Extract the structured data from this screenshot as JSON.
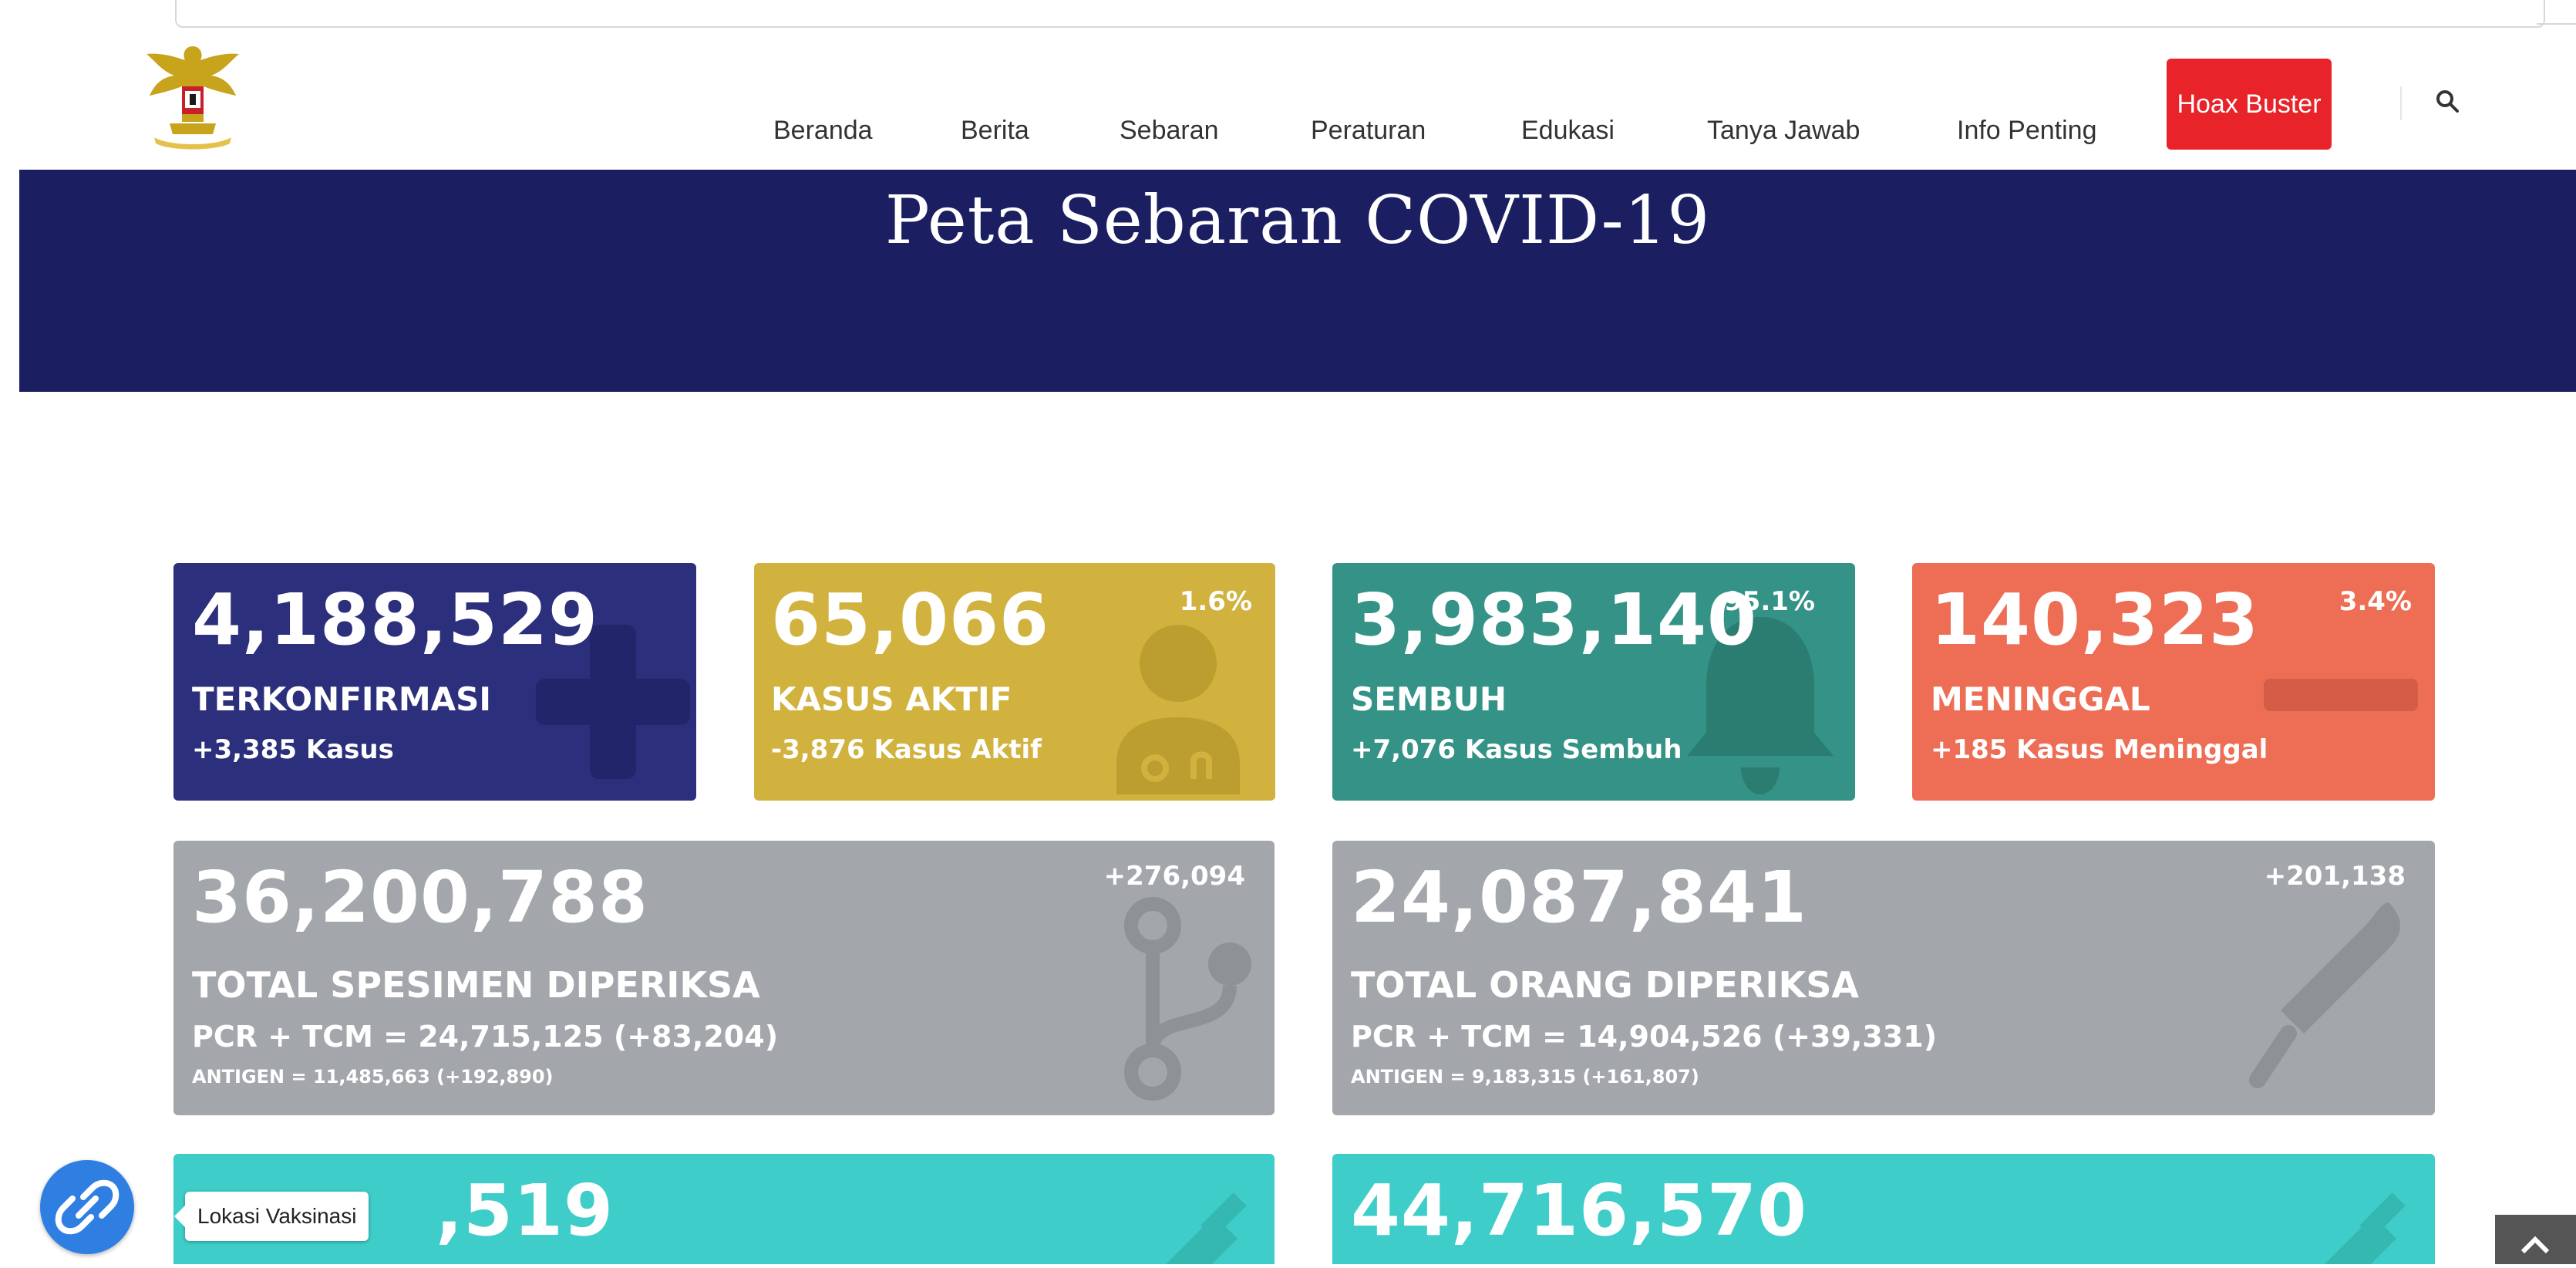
{
  "nav": {
    "items": [
      "Beranda",
      "Berita",
      "Sebaran",
      "Peraturan",
      "Edukasi",
      "Tanya Jawab",
      "Info Penting"
    ],
    "hoax_label": "Hoax Buster"
  },
  "hero": {
    "title": "Peta Sebaran COVID-19"
  },
  "stats": {
    "confirmed": {
      "value": "4,188,529",
      "label": "TERKONFIRMASI",
      "change": "+3,385 Kasus"
    },
    "active": {
      "value": "65,066",
      "label": "KASUS AKTIF",
      "change": "-3,876 Kasus Aktif",
      "percent": "1.6%"
    },
    "recovered": {
      "value": "3,983,140",
      "label": "SEMBUH",
      "change": "+7,076 Kasus Sembuh",
      "percent": "95.1%"
    },
    "deaths": {
      "value": "140,323",
      "label": "MENINGGAL",
      "change": "+185 Kasus Meninggal",
      "percent": "3.4%"
    }
  },
  "specimens": {
    "value": "36,200,788",
    "delta": "+276,094",
    "label": "TOTAL SPESIMEN DIPERIKSA",
    "pcr": "PCR + TCM = 24,715,125 (+83,204)",
    "antigen": "ANTIGEN = 11,485,663 (+192,890)"
  },
  "people": {
    "value": "24,087,841",
    "delta": "+201,138",
    "label": "TOTAL ORANG DIPERIKSA",
    "pcr": "PCR + TCM = 14,904,526 (+39,331)",
    "antigen": "ANTIGEN = 9,183,315 (+161,807)"
  },
  "vaccine": {
    "left_value": ",519",
    "right_value": "44,716,570"
  },
  "floating": {
    "tooltip": "Lokasi Vaksinasi"
  },
  "colors": {
    "hero_bg": "#1b1f61",
    "confirmed": "#2b2f7c",
    "active": "#d1b23e",
    "recovered": "#349386",
    "deaths": "#ed6e55",
    "gray": "#a3a6ab",
    "vaccine": "#3ecdc8",
    "hoax": "#e8232a"
  },
  "icons": {
    "search": "search-icon",
    "confirmed": "plus-icon",
    "active": "doctor-icon",
    "recovered": "bell-icon",
    "deaths": "minus-icon",
    "specimens": "flow-icon",
    "people": "thermometer-icon",
    "vaccine": "syringe-icon",
    "floating": "link-icon",
    "scroll": "chevron-up-icon"
  }
}
